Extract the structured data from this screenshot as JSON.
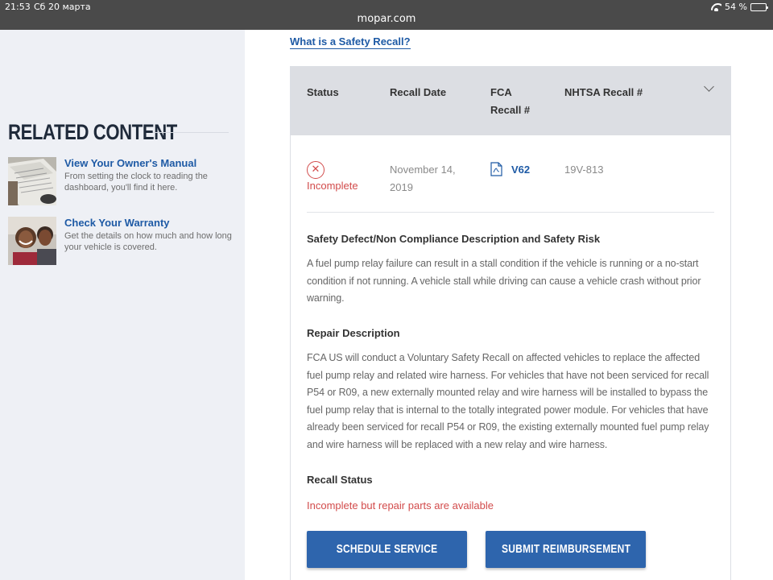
{
  "status_bar": {
    "time": "21:53",
    "date": "Сб 20 марта",
    "url": "mopar.com",
    "battery": "54 %",
    "battery_level": 0.54
  },
  "sidebar": {
    "title": "RELATED CONTENT",
    "items": [
      {
        "title": "View Your Owner's Manual",
        "description": "From setting the clock to reading the dashboard, you'll find it here.",
        "thumb_icon": "owners-manual-thumbnail"
      },
      {
        "title": "Check Your Warranty",
        "description": "Get the details on how much and how long your vehicle is covered.",
        "thumb_icon": "warranty-couple-thumbnail"
      }
    ]
  },
  "main": {
    "what_link": "What is a Safety Recall?",
    "table": {
      "headers": {
        "status": "Status",
        "date": "Recall Date",
        "fca_line1": "FCA",
        "fca_line2": "Recall #",
        "nhtsa": "NHTSA Recall #"
      },
      "row": {
        "status": "Incomplete",
        "date": "November 14, 2019",
        "fca": "V62",
        "nhtsa": "19V-813"
      }
    },
    "sections": [
      {
        "title": "Safety Defect/Non Compliance Description and Safety Risk",
        "body": "A fuel pump relay failure can result in a stall condition if the vehicle is running or a no-start condition if not running. A vehicle stall while driving can cause a vehicle crash without prior warning."
      },
      {
        "title": "Repair Description",
        "body": "FCA US will conduct a Voluntary Safety Recall on affected vehicles to replace the affected fuel pump relay and related wire harness. For vehicles that have not been serviced for recall P54 or R09, a new externally mounted relay and wire harness will be installed to bypass the fuel pump relay that is internal to the totally integrated power module. For vehicles that have already been serviced for recall P54 or R09, the existing externally mounted fuel pump relay and wire harness will be replaced with a new relay and wire harness."
      }
    ],
    "recall_status": {
      "title": "Recall Status",
      "value": "Incomplete but repair parts are available"
    },
    "buttons": {
      "schedule": "SCHEDULE SERVICE",
      "reimburse": "SUBMIT REIMBURSEMENT"
    }
  },
  "colors": {
    "brand_blue": "#2e65ad",
    "link_blue": "#1e5aa5",
    "error_red": "#d24b4b",
    "header_gray": "#dcdee3",
    "sidebar_bg": "#eef0f5"
  }
}
